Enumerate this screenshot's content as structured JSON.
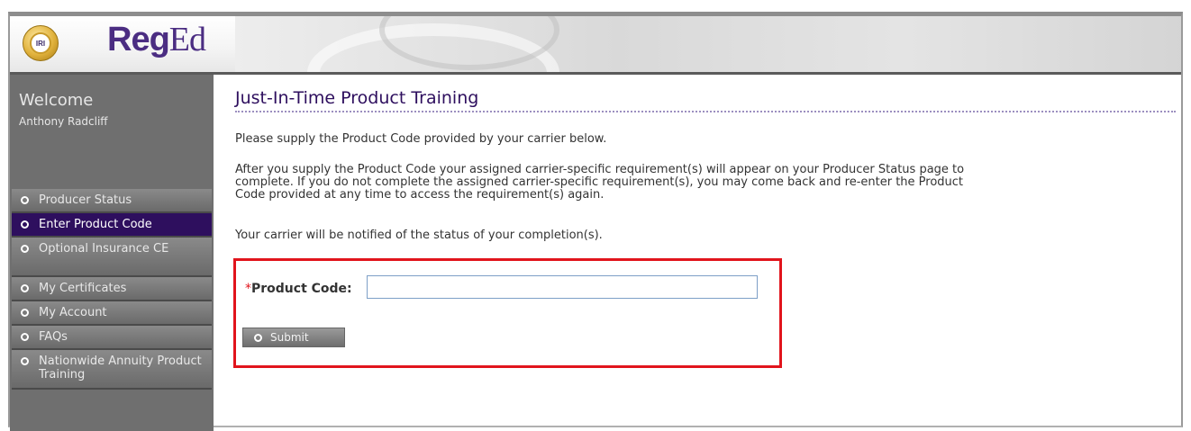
{
  "brand": {
    "badge_text": "IRI",
    "logo_bold": "Reg",
    "logo_rest": "Ed",
    "brand_color": "#4b2d82"
  },
  "sidebar": {
    "welcome": "Welcome",
    "user_name": "Anthony  Radcliff",
    "items": [
      {
        "label": "Producer Status",
        "active": false
      },
      {
        "label": "Enter Product Code",
        "active": true
      },
      {
        "label": "Optional Insurance CE",
        "active": false
      },
      {
        "label": "My Certificates",
        "active": false
      },
      {
        "label": "My Account",
        "active": false
      },
      {
        "label": "FAQs",
        "active": false
      },
      {
        "label": "Nationwide Annuity Product Training",
        "active": false
      }
    ]
  },
  "main": {
    "title": "Just-In-Time Product Training",
    "para1": "Please supply the Product Code provided by your carrier below.",
    "para2_line1": "After you supply the Product Code your assigned carrier-specific requirement(s) will appear on your Producer Status page to",
    "para2_line2": "complete. If you do not complete the assigned carrier-specific requirement(s), you may come back and re-enter the Product",
    "para2_line3": "Code provided at any time to access the requirement(s) again.",
    "para3": "Your carrier will be notified of the status of your completion(s)."
  },
  "form": {
    "required_mark": "*",
    "product_code_label": "Product Code:",
    "product_code_value": "",
    "submit_label": "Submit"
  },
  "colors": {
    "accent": "#2e0f5e",
    "highlight_border": "#e1141c",
    "sidebar_bg": "#6f6f6f"
  }
}
